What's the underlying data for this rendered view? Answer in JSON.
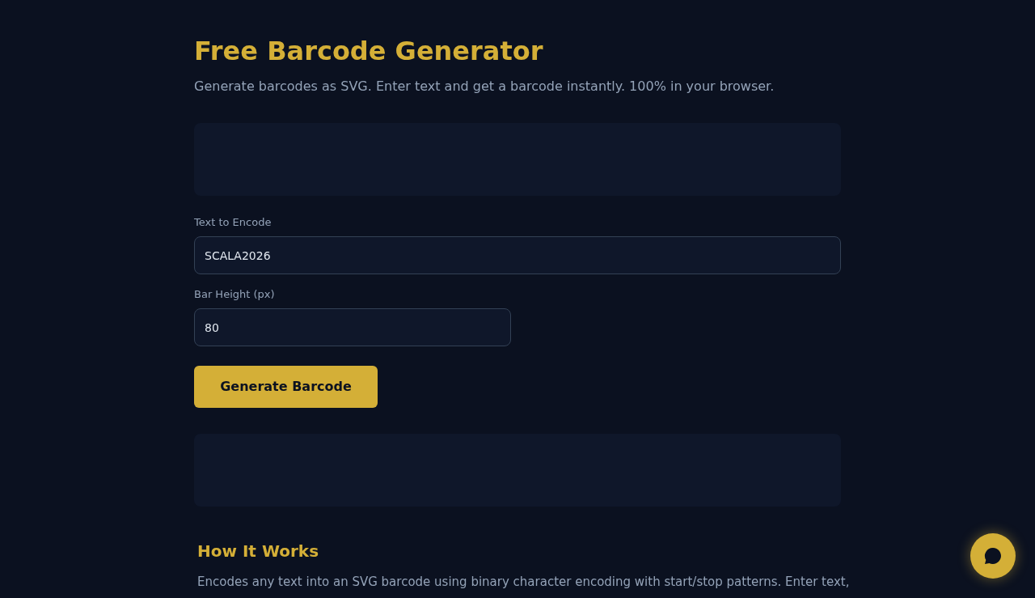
{
  "title": "Free Barcode Generator",
  "subtitle": "Generate barcodes as SVG. Enter text and get a barcode instantly. 100% in your browser.",
  "form": {
    "fields": [
      {
        "kind": "text",
        "label": "Text to Encode",
        "value": "SCALA2026"
      },
      {
        "kind": "number",
        "label": "Bar Height (px)",
        "value": "80"
      }
    ],
    "button": "Generate Barcode"
  },
  "how_it_works": {
    "heading": "How It Works",
    "text": "Encodes any text into an SVG barcode using binary character encoding with start/stop patterns. Enter text,"
  }
}
